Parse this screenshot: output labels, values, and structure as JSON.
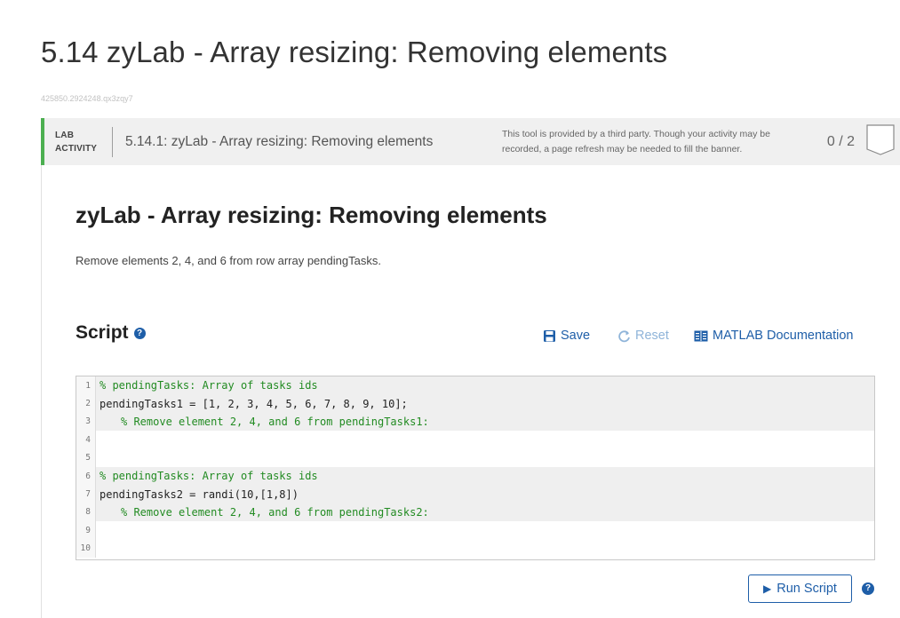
{
  "page": {
    "title": "5.14 zyLab - Array resizing: Removing elements",
    "id": "425850.2924248.qx3zqy7"
  },
  "banner": {
    "lab_label_1": "LAB",
    "lab_label_2": "ACTIVITY",
    "title": "5.14.1: zyLab - Array resizing: Removing elements",
    "note_1": "This tool is provided by a third party. Though your activity may be",
    "note_2": "recorded, a page refresh may be needed to fill the banner.",
    "score": "0 / 2"
  },
  "lab": {
    "heading": "zyLab - Array resizing: Removing elements",
    "description": "Remove elements 2, 4, and 6 from row array pendingTasks."
  },
  "script": {
    "title": "Script",
    "save_label": "Save",
    "reset_label": "Reset",
    "docs_label": "MATLAB Documentation"
  },
  "editor": {
    "lines": [
      {
        "num": "1",
        "text": "% pendingTasks: Array of tasks ids"
      },
      {
        "num": "2",
        "text": "pendingTasks1 = [1, 2, 3, 4, 5, 6, 7, 8, 9, 10];"
      },
      {
        "num": "3",
        "text": "% Remove element 2, 4, and 6 from pendingTasks1:"
      },
      {
        "num": "4",
        "text": ""
      },
      {
        "num": "5",
        "text": ""
      },
      {
        "num": "6",
        "text": "% pendingTasks: Array of tasks ids"
      },
      {
        "num": "7",
        "text": "pendingTasks2 = randi(10,[1,8])"
      },
      {
        "num": "8",
        "text": "% Remove element 2, 4, and 6 from pendingTasks2:"
      },
      {
        "num": "9",
        "text": ""
      },
      {
        "num": "10",
        "text": ""
      }
    ]
  },
  "run": {
    "label": "Run Script"
  },
  "colors": {
    "accent": "#1e5ea8",
    "banner_border": "#4caf50",
    "comment": "#228b22"
  }
}
